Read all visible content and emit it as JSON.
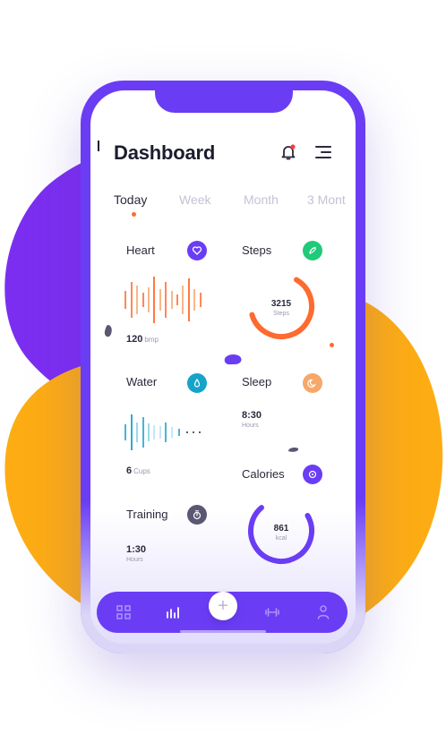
{
  "header": {
    "title": "Dashboard",
    "has_notification": true
  },
  "tabs": [
    {
      "label": "Today",
      "active": true
    },
    {
      "label": "Week",
      "active": false
    },
    {
      "label": "Month",
      "active": false
    },
    {
      "label": "3 Mont",
      "active": false
    }
  ],
  "cards": {
    "heart": {
      "label": "Heart",
      "value": "120",
      "unit": "bmp",
      "icon": "heart-icon",
      "color": "#6a3df5"
    },
    "steps": {
      "label": "Steps",
      "value": "3215",
      "unit": "Steps",
      "icon": "shoe-icon",
      "color": "#21c97a",
      "progress": 0.62
    },
    "water": {
      "label": "Water",
      "value": "6",
      "unit": "Cups",
      "icon": "water-drop-icon",
      "color": "#16a3c9"
    },
    "sleep": {
      "label": "Sleep",
      "value": "8:30",
      "unit": "Hours",
      "icon": "moon-icon",
      "color": "#f7a76a"
    },
    "training": {
      "label": "Training",
      "value": "1:30",
      "unit": "Hours",
      "icon": "stopwatch-icon",
      "color": "#5a5773"
    },
    "calories": {
      "label": "Calories",
      "value": "861",
      "unit": "kcal",
      "icon": "flame-icon",
      "color": "#6a3df5",
      "progress": 0.72
    }
  },
  "navbar": {
    "items": [
      "grid-icon",
      "bar-chart-icon",
      "plus-icon",
      "dumbbell-icon",
      "person-icon"
    ],
    "active": "bar-chart-icon",
    "fab_label": "+"
  },
  "colors": {
    "accent_purple": "#6a3df5",
    "accent_orange": "#ff6a2f",
    "blob_orange": "#fdad13",
    "blob_purple": "#7c2ef0"
  }
}
